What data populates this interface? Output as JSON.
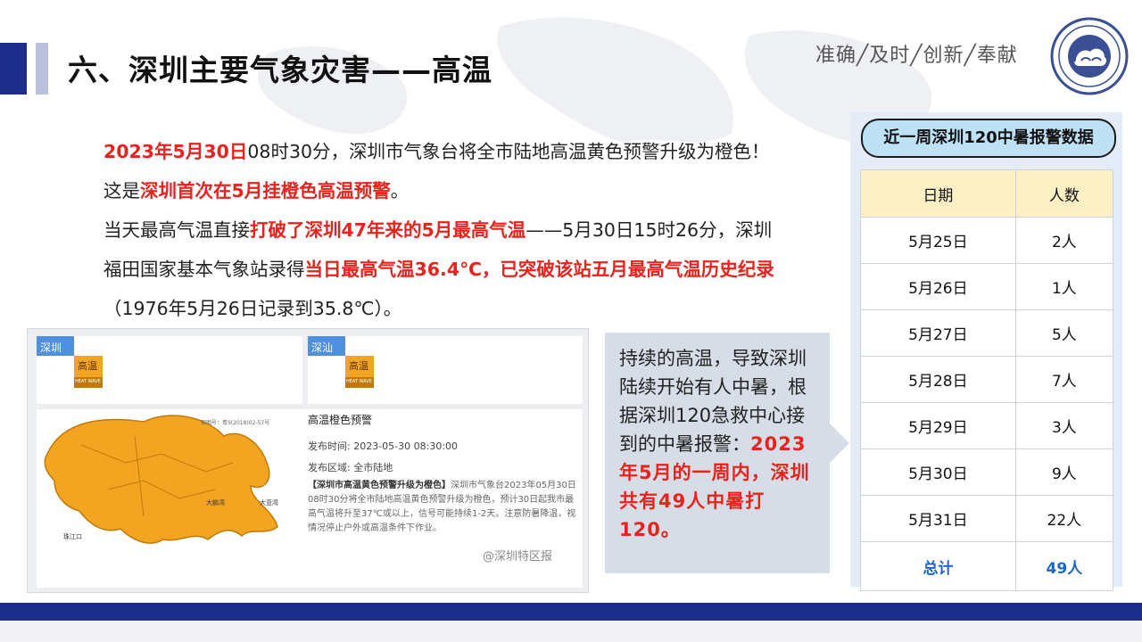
{
  "header": {
    "title": "六、深圳主要气象灾害——高温",
    "slogan": "准确╱及时╱创新╱奉献"
  },
  "paragraph": {
    "l1_red": "2023年5月30日",
    "l1_text": "08时30分，深圳市气象台将全市陆地高温黄色预警升级为橙色！这是",
    "l1_red2": "深圳首次在5月挂橙色高温预警",
    "l1_end": "。",
    "l2_text": "当天最高气温直接",
    "l2_red": "打破了深圳47年来的5月最高气温",
    "l2_text2": "——5月30日15时26分，深圳福田国家基本气象站录得",
    "l2_red2": "当日最高气温36.4℃，已突破该站五月最高气温历史纪录",
    "l2_end": "（1976年5月26日记录到35.8℃）。"
  },
  "map_card": {
    "region1": "深圳",
    "region2": "深汕",
    "sign_top": "高温",
    "sign_color": "橙",
    "sign_en": "HEAT WAVE",
    "right_badge": "",
    "code": "审图号：粤S(2018)02-57号",
    "warning_title": "高温橙色预警",
    "release_time": "发布时间:  2023-05-30 08:30:00",
    "release_area": "发布区域:  全市陆地",
    "body_bold": "【深圳市高温黄色预警升级为橙色】",
    "body_text": "深圳市气象台2023年05月30日08时30分将全市陆地高温黄色预警升级为橙色，预计30日起我市最高气温将升至37℃或以上，信号可能持续1-2天。注意防暑降温，视情况停止户外或高温条件下作业。",
    "watermark": "@深圳特区报",
    "place_labels": [
      "大鹏湾",
      "大亚湾",
      "珠江口"
    ]
  },
  "info_box": {
    "text": "持续的高温，导致深圳陆续开始有人中暑，根据深圳120急救中心接到的中暑报警：",
    "red": "2023年5月的一周内，深圳共有49人中暑打120。"
  },
  "table": {
    "caption": "近一周深圳120中暑报警数据",
    "headers": [
      "日期",
      "人数"
    ],
    "rows": [
      [
        "5月25日",
        "2人"
      ],
      [
        "5月26日",
        "1人"
      ],
      [
        "5月27日",
        "5人"
      ],
      [
        "5月28日",
        "7人"
      ],
      [
        "5月29日",
        "3人"
      ],
      [
        "5月30日",
        "9人"
      ],
      [
        "5月31日",
        "22人"
      ]
    ],
    "total": [
      "总计",
      "49人"
    ]
  },
  "colors": {
    "brand_dark": "#1f2d8a",
    "red": "#e8231d",
    "warning_orange": "#f3a521",
    "table_header": "#fdf0c4",
    "caption_blue": "#bfe1f6"
  }
}
